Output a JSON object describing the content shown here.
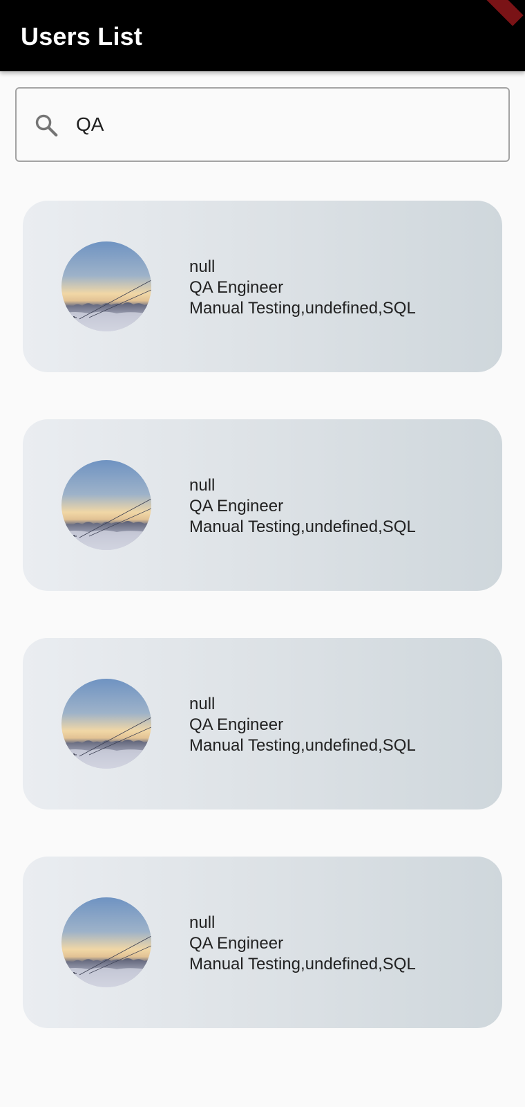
{
  "app_bar": {
    "title": "Users List",
    "background": "#000000",
    "title_color": "#ffffff"
  },
  "search": {
    "icon": "search-icon",
    "value": "QA",
    "placeholder": ""
  },
  "users": [
    {
      "name": "null",
      "role": "QA Engineer",
      "skills": "Manual Testing,undefined,SQL",
      "avatar": "landscape-avatar"
    },
    {
      "name": "null",
      "role": "QA Engineer",
      "skills": "Manual Testing,undefined,SQL",
      "avatar": "landscape-avatar"
    },
    {
      "name": "null",
      "role": "QA Engineer",
      "skills": "Manual Testing,undefined,SQL",
      "avatar": "landscape-avatar"
    },
    {
      "name": "null",
      "role": "QA Engineer",
      "skills": "Manual Testing,undefined,SQL",
      "avatar": "landscape-avatar"
    }
  ],
  "colors": {
    "card_gradient_start": "#eaedf1",
    "card_gradient_end": "#cfd7dc",
    "page_background": "#fafafa"
  }
}
